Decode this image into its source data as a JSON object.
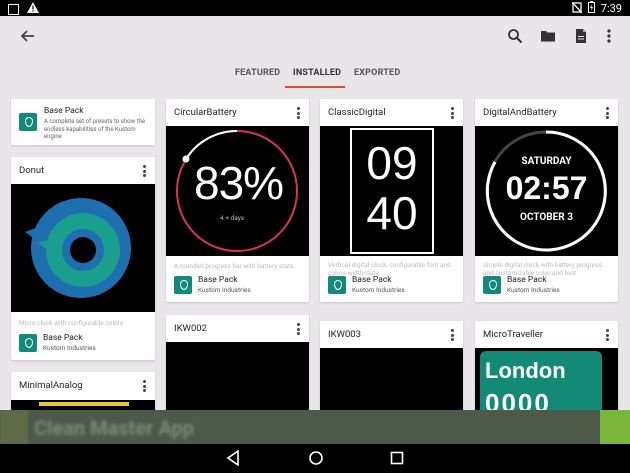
{
  "status_bar": {
    "time": "7:39"
  },
  "app_bar": {
    "icons": [
      "back-arrow-icon",
      "search-icon",
      "folder-icon",
      "document-icon",
      "more-vert-icon"
    ]
  },
  "tabs": [
    {
      "label": "FEATURED",
      "active": false
    },
    {
      "label": "INSTALLED",
      "active": true
    },
    {
      "label": "EXPORTED",
      "active": false
    }
  ],
  "colors": {
    "accent": "#e04a2c",
    "background": "#e8e6e8",
    "author_logo": "#128a7a"
  },
  "cards": {
    "base_pack": {
      "title": "Base Pack",
      "description": "A complete set of presets to show the endless kapabilities of the Kustom engine"
    },
    "donut": {
      "title": "Donut",
      "description": "Micro clock with configurable colors",
      "author": "Base Pack",
      "company": "Kustom Industries"
    },
    "minimal_analog": {
      "title": "MinimalAnalog"
    },
    "circular_battery": {
      "title": "CircularBattery",
      "percent": "83%",
      "sub": "4 + days",
      "description": "A rounded progress bar with battery stats",
      "author": "Base Pack",
      "company": "Kustom Industries"
    },
    "ikw002": {
      "title": "IKW002"
    },
    "classic_digital": {
      "title": "ClassicDigital",
      "hours": "09",
      "minutes": "40",
      "description": "Vertical digital clock, configurable font and colors width/date",
      "author": "Base Pack",
      "company": "Kustom Industries"
    },
    "ikw003": {
      "title": "IKW003"
    },
    "digital_and_battery": {
      "title": "DigitalAndBattery",
      "day": "SATURDAY",
      "time": "02:57",
      "date": "OCTOBER 3",
      "description": "Simple digital clock with battery progress and customizable color and font",
      "author": "Base Pack",
      "company": "Kustom Industries"
    },
    "micro_traveller": {
      "title": "MicroTraveller",
      "city": "London",
      "digits": "0000"
    }
  },
  "ad": {
    "text": "Clean Master App"
  }
}
